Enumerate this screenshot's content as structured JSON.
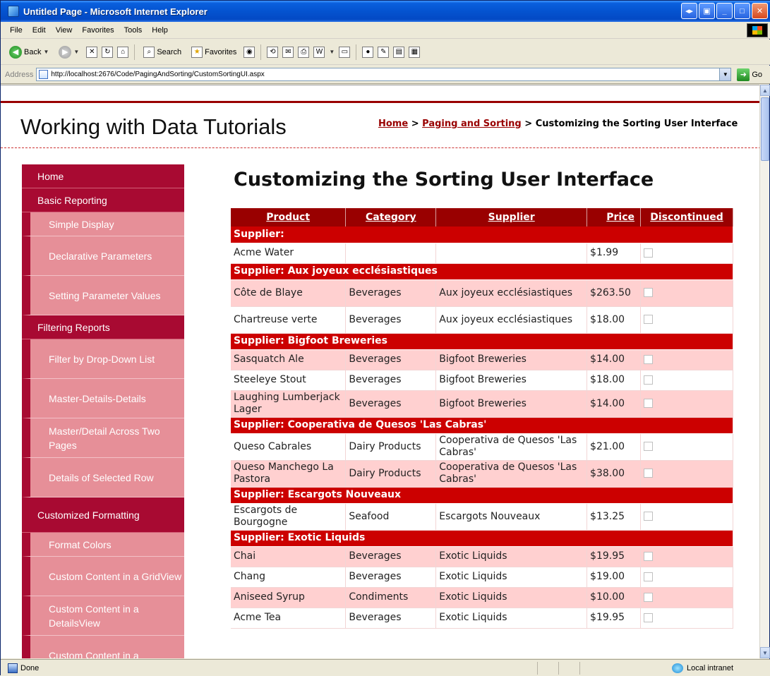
{
  "window": {
    "title": "Untitled Page - Microsoft Internet Explorer"
  },
  "menu": [
    "File",
    "Edit",
    "View",
    "Favorites",
    "Tools",
    "Help"
  ],
  "toolbar": {
    "back": "Back",
    "search": "Search",
    "favorites": "Favorites"
  },
  "address": {
    "label": "Address",
    "url": "http://localhost:2676/Code/PagingAndSorting/CustomSortingUI.aspx",
    "go": "Go"
  },
  "header": {
    "site_title": "Working with Data Tutorials",
    "crumb_home": "Home",
    "crumb_sep1": " > ",
    "crumb_paging": "Paging and Sorting",
    "crumb_sep2": " > ",
    "crumb_current": "Customizing the Sorting User Interface"
  },
  "sidebar": {
    "home": "Home",
    "basic_reporting": "Basic Reporting",
    "simple_display": "Simple Display",
    "declarative_parameters": "Declarative Parameters",
    "setting_parameter_values": "Setting Parameter Values",
    "filtering_reports": "Filtering Reports",
    "filter_dropdown": "Filter by Drop-Down List",
    "master_details": "Master-Details-Details",
    "master_detail_pages": "Master/Detail Across Two Pages",
    "details_selected": "Details of Selected Row",
    "customized_formatting": "Customized Formatting",
    "format_colors": "Format Colors",
    "custom_gridview": "Custom Content in a GridView",
    "custom_detailsview": "Custom Content in a DetailsView",
    "custom_formview": "Custom Content in a"
  },
  "main": {
    "page_title": "Customizing the Sorting User Interface",
    "columns": [
      "Product",
      "Category",
      "Supplier",
      "Price",
      "Discontinued"
    ],
    "rows": [
      {
        "type": "group",
        "text": "Supplier:"
      },
      {
        "type": "norm",
        "product": "Acme Water",
        "category": "",
        "supplier": "",
        "price": "$1.99"
      },
      {
        "type": "group",
        "text": "Supplier: Aux joyeux ecclésiastiques"
      },
      {
        "type": "alt tall",
        "product": "Côte de Blaye",
        "category": "Beverages",
        "supplier": "Aux joyeux ecclésiastiques",
        "price": "$263.50"
      },
      {
        "type": "norm tall",
        "product": "Chartreuse verte",
        "category": "Beverages",
        "supplier": "Aux joyeux ecclésiastiques",
        "price": "$18.00"
      },
      {
        "type": "group",
        "text": "Supplier: Bigfoot Breweries"
      },
      {
        "type": "alt",
        "product": "Sasquatch Ale",
        "category": "Beverages",
        "supplier": "Bigfoot Breweries",
        "price": "$14.00"
      },
      {
        "type": "norm",
        "product": "Steeleye Stout",
        "category": "Beverages",
        "supplier": "Bigfoot Breweries",
        "price": "$18.00"
      },
      {
        "type": "alt tall",
        "product": "Laughing Lumberjack Lager",
        "category": "Beverages",
        "supplier": "Bigfoot Breweries",
        "price": "$14.00"
      },
      {
        "type": "group",
        "text": "Supplier: Cooperativa de Quesos 'Las Cabras'"
      },
      {
        "type": "norm tall",
        "product": "Queso Cabrales",
        "category": "Dairy Products",
        "supplier": "Cooperativa de Quesos 'Las Cabras'",
        "price": "$21.00"
      },
      {
        "type": "alt tall",
        "product": "Queso Manchego La Pastora",
        "category": "Dairy Products",
        "supplier": "Cooperativa de Quesos 'Las Cabras'",
        "price": "$38.00"
      },
      {
        "type": "group",
        "text": "Supplier: Escargots Nouveaux"
      },
      {
        "type": "norm tall",
        "product": "Escargots de Bourgogne",
        "category": "Seafood",
        "supplier": "Escargots Nouveaux",
        "price": "$13.25"
      },
      {
        "type": "group",
        "text": "Supplier: Exotic Liquids"
      },
      {
        "type": "alt",
        "product": "Chai",
        "category": "Beverages",
        "supplier": "Exotic Liquids",
        "price": "$19.95"
      },
      {
        "type": "norm",
        "product": "Chang",
        "category": "Beverages",
        "supplier": "Exotic Liquids",
        "price": "$19.00"
      },
      {
        "type": "alt",
        "product": "Aniseed Syrup",
        "category": "Condiments",
        "supplier": "Exotic Liquids",
        "price": "$10.00"
      },
      {
        "type": "norm",
        "product": "Acme Tea",
        "category": "Beverages",
        "supplier": "Exotic Liquids",
        "price": "$19.95"
      }
    ]
  },
  "status": {
    "left": "Done",
    "zone": "Local intranet"
  },
  "colors": {
    "accent": "#990000",
    "group_row": "#cc0000",
    "alt_row": "#ffd0d0",
    "nav_dark": "#a80a32",
    "nav_light": "#e68f98"
  }
}
